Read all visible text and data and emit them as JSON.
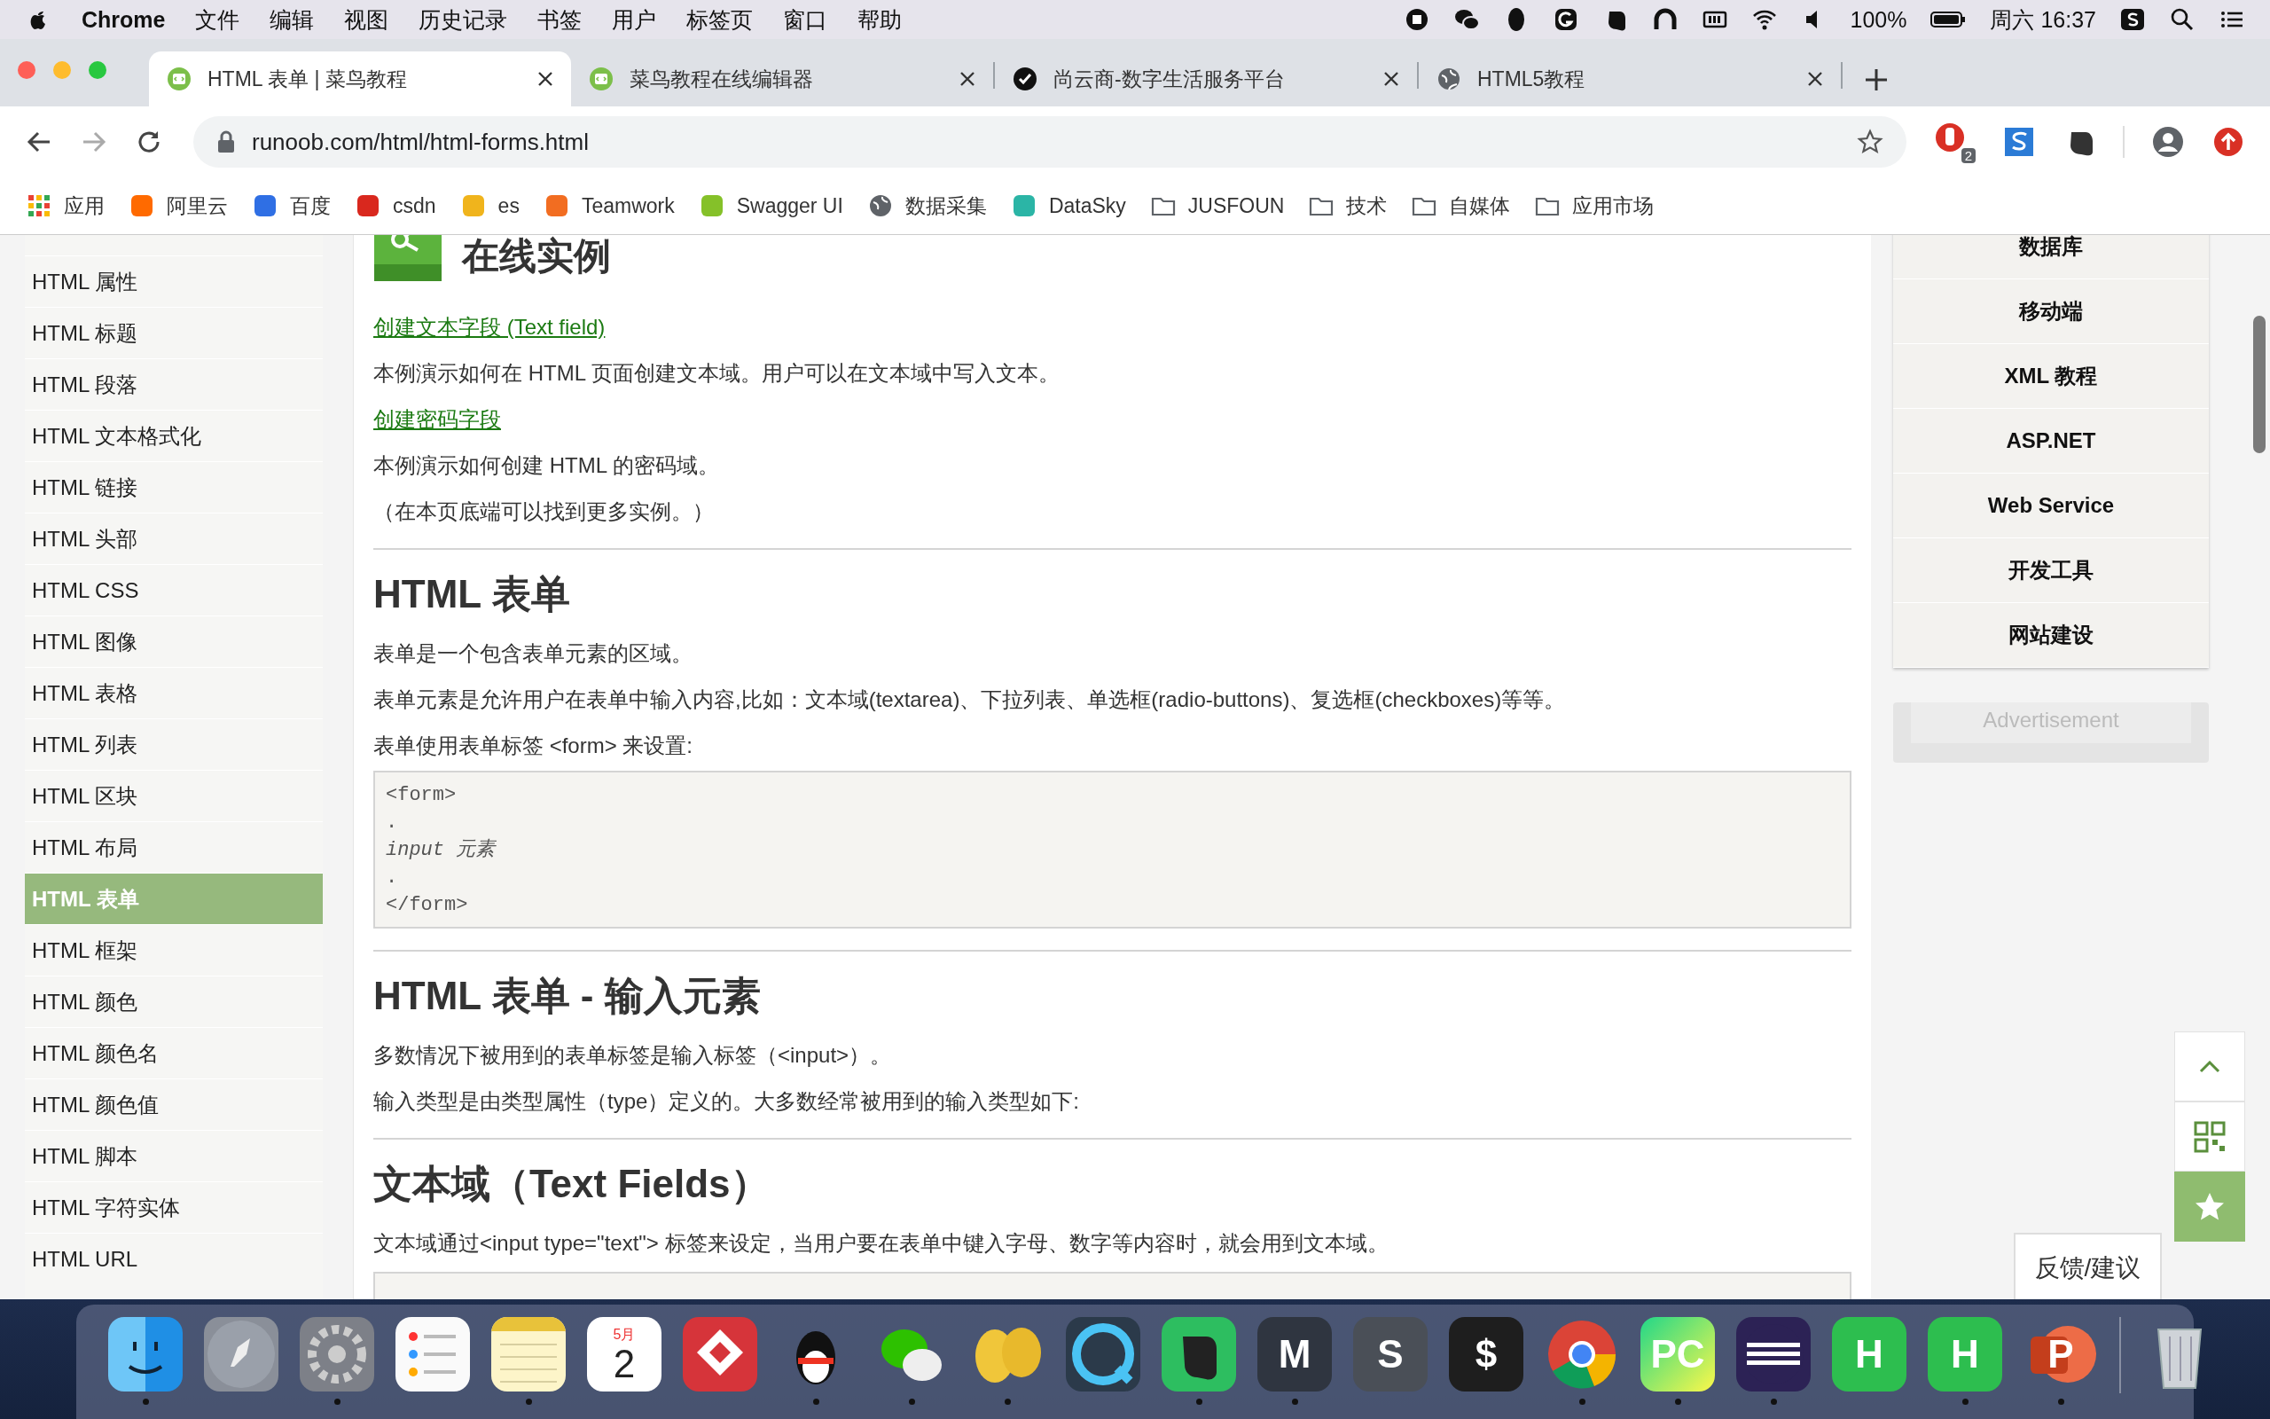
{
  "menu_bar": {
    "app": "Chrome",
    "menus": [
      "文件",
      "编辑",
      "视图",
      "历史记录",
      "书签",
      "用户",
      "标签页",
      "窗口",
      "帮助"
    ],
    "battery": "100%",
    "clock": "周六 16:37"
  },
  "tabs": [
    {
      "title": "HTML 表单 | 菜鸟教程",
      "kind": "runoob",
      "selected": true
    },
    {
      "title": "菜鸟教程在线编辑器",
      "kind": "runoob",
      "selected": false
    },
    {
      "title": "尚云商-数字生活服务平台",
      "kind": "check",
      "selected": false
    },
    {
      "title": "HTML5教程",
      "kind": "globe",
      "selected": false
    }
  ],
  "address_bar": {
    "url": "runoob.com/html/html-forms.html"
  },
  "extension_badge": "2",
  "bookmarks": [
    {
      "label": "应用",
      "kind": "apps"
    },
    {
      "label": "阿里云",
      "kind": "site",
      "color": "#ff6a00"
    },
    {
      "label": "百度",
      "kind": "site",
      "color": "#2f6fe4"
    },
    {
      "label": "csdn",
      "kind": "site",
      "color": "#d9281e"
    },
    {
      "label": "es",
      "kind": "site",
      "color": "#f0b41c"
    },
    {
      "label": "Teamwork",
      "kind": "site",
      "color": "#f26d21"
    },
    {
      "label": "Swagger UI",
      "kind": "site",
      "color": "#85c129"
    },
    {
      "label": "数据采集",
      "kind": "globe"
    },
    {
      "label": "DataSky",
      "kind": "site",
      "color": "#2bb5a6"
    },
    {
      "label": "JUSFOUN",
      "kind": "folder"
    },
    {
      "label": "技术",
      "kind": "folder"
    },
    {
      "label": "自媒体",
      "kind": "folder"
    },
    {
      "label": "应用市场",
      "kind": "folder"
    }
  ],
  "sidebar": {
    "items": [
      {
        "label": "HTML 属性",
        "selected": false
      },
      {
        "label": "HTML 标题",
        "selected": false
      },
      {
        "label": "HTML 段落",
        "selected": false
      },
      {
        "label": "HTML 文本格式化",
        "selected": false
      },
      {
        "label": "HTML 链接",
        "selected": false
      },
      {
        "label": "HTML 头部",
        "selected": false
      },
      {
        "label": "HTML CSS",
        "selected": false
      },
      {
        "label": "HTML 图像",
        "selected": false
      },
      {
        "label": "HTML 表格",
        "selected": false
      },
      {
        "label": "HTML 列表",
        "selected": false
      },
      {
        "label": "HTML 区块",
        "selected": false
      },
      {
        "label": "HTML 布局",
        "selected": false
      },
      {
        "label": "HTML 表单",
        "selected": true
      },
      {
        "label": "HTML 框架",
        "selected": false
      },
      {
        "label": "HTML 颜色",
        "selected": false
      },
      {
        "label": "HTML 颜色名",
        "selected": false
      },
      {
        "label": "HTML 颜色值",
        "selected": false
      },
      {
        "label": "HTML 脚本",
        "selected": false
      },
      {
        "label": "HTML 字符实体",
        "selected": false
      },
      {
        "label": "HTML URL",
        "selected": false
      }
    ]
  },
  "content": {
    "blocks": [
      {
        "kind": "example_heading",
        "text": "在线实例"
      },
      {
        "kind": "link",
        "text": "创建文本字段 (Text field)"
      },
      {
        "kind": "para",
        "text": "本例演示如何在 HTML 页面创建文本域。用户可以在文本域中写入文本。"
      },
      {
        "kind": "link",
        "text": "创建密码字段"
      },
      {
        "kind": "para",
        "text": "本例演示如何创建 HTML 的密码域。"
      },
      {
        "kind": "para",
        "text": "（在本页底端可以找到更多实例。）"
      },
      {
        "kind": "rule"
      },
      {
        "kind": "h2",
        "text": "HTML 表单"
      },
      {
        "kind": "para",
        "text": "表单是一个包含表单元素的区域。"
      },
      {
        "kind": "para",
        "text": "表单元素是允许用户在表单中输入内容,比如：文本域(textarea)、下拉列表、单选框(radio-buttons)、复选框(checkboxes)等等。"
      },
      {
        "kind": "para",
        "text": "表单使用表单标签 <form> 来设置:"
      },
      {
        "kind": "code",
        "lines": [
          {
            "text": "<form>",
            "italic": false
          },
          {
            "text": ".",
            "italic": false
          },
          {
            "text": "input 元素",
            "italic": true
          },
          {
            "text": ".",
            "italic": false
          },
          {
            "text": "</form>",
            "italic": false
          }
        ]
      },
      {
        "kind": "rule"
      },
      {
        "kind": "h2",
        "text": "HTML 表单 - 输入元素"
      },
      {
        "kind": "para",
        "text": "多数情况下被用到的表单标签是输入标签（<input>）。"
      },
      {
        "kind": "para",
        "text": "输入类型是由类型属性（type）定义的。大多数经常被用到的输入类型如下:"
      },
      {
        "kind": "rule"
      },
      {
        "kind": "h2",
        "text": "文本域（Text Fields）"
      },
      {
        "kind": "para",
        "text": "文本域通过<input type=\"text\"> 标签来设定，当用户要在表单中键入字母、数字等内容时，就会用到文本域。"
      },
      {
        "kind": "code_stub"
      }
    ]
  },
  "right_nav": {
    "items": [
      "数据库",
      "移动端",
      "XML 教程",
      "ASP.NET",
      "Web Service",
      "开发工具",
      "网站建设"
    ]
  },
  "advertisement": "Advertisement",
  "feedback": "反馈/建议",
  "dock": [
    {
      "kind": "finder",
      "running": true
    },
    {
      "kind": "launchpad",
      "running": false
    },
    {
      "kind": "settings",
      "running": true
    },
    {
      "kind": "reminders",
      "running": false
    },
    {
      "kind": "notes",
      "running": true
    },
    {
      "kind": "calendar",
      "running": false,
      "month": "5月",
      "day": "2"
    },
    {
      "kind": "git",
      "running": false
    },
    {
      "kind": "qq",
      "running": true
    },
    {
      "kind": "wechat",
      "running": true
    },
    {
      "kind": "yellow",
      "running": true
    },
    {
      "kind": "quicktime",
      "running": false
    },
    {
      "kind": "evernote",
      "running": true
    },
    {
      "kind": "markdown",
      "running": true,
      "glyph": "M"
    },
    {
      "kind": "sublime",
      "running": false,
      "glyph": "S"
    },
    {
      "kind": "terminal",
      "running": false,
      "glyph": "$"
    },
    {
      "kind": "chrome",
      "running": true
    },
    {
      "kind": "pycharm",
      "running": true,
      "glyph": "PC"
    },
    {
      "kind": "eclipse",
      "running": true
    },
    {
      "kind": "hbuilder",
      "running": false,
      "glyph": "H"
    },
    {
      "kind": "hbuilder",
      "running": true,
      "glyph": "H"
    },
    {
      "kind": "powerpoint",
      "running": true,
      "glyph": "P"
    },
    {
      "kind": "trash",
      "running": false
    }
  ]
}
